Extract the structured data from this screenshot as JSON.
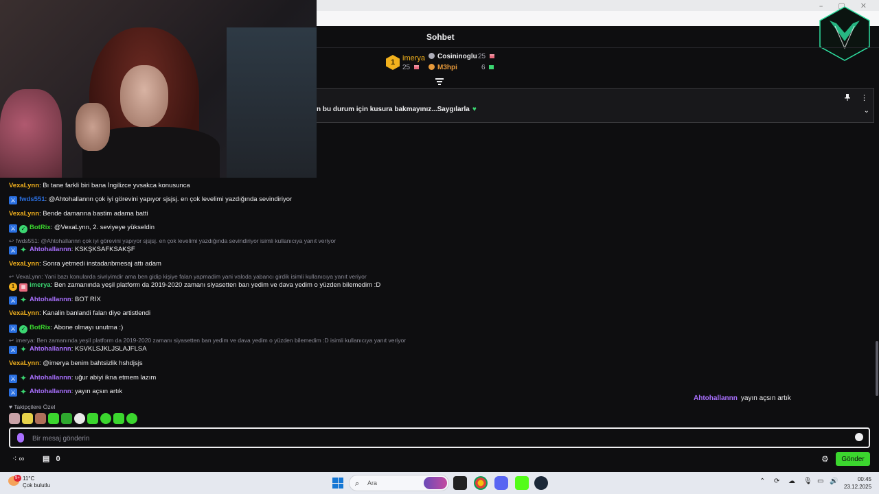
{
  "window": {
    "minimize": "–",
    "maximize": "▢",
    "close": "✕"
  },
  "chat_header": {
    "title": "Sohbet"
  },
  "leaderboard": {
    "first": {
      "rank": "1",
      "name": "imerya",
      "value": "25"
    },
    "second": {
      "name": "Cosininoglu",
      "value": "25"
    },
    "third": {
      "name": "M3hpi",
      "value": "6"
    }
  },
  "pinned": {
    "text": "n bu durum için kusura bakmayınız...Saygılarla",
    "heart": "♥"
  },
  "messages": [
    {
      "user": "VexaLynn",
      "text": ": Bı tane farkli biri bana İngilizce yvsakca konusunca"
    },
    {
      "user": "fwds551",
      "text": ": @Ahtohallannn çok iyi görevini yapıyor sjsjsj. en çok levelimi yazdığında sevindiriyor"
    },
    {
      "user": "VexaLynn",
      "text": ": Bende damarına bastim adama batti"
    },
    {
      "user": "BotRix",
      "text": ": @VexaLynn, 2. seviyeye yükseldin"
    },
    {
      "reply": "fwds551: @Ahtohallannn çok iyi görevini yapıyor sjsjsj. en çok levelimi yazdığında sevindiriyor isimli kullanıcıya yanıt veriyor"
    },
    {
      "user": "Ahtohallannn",
      "text": ": KSKŞKSAFKSAKŞF"
    },
    {
      "user": "VexaLynn",
      "text": ": Sonra yetmedi instadanbmesaj attı adam"
    },
    {
      "reply": "VexaLynn: Yani bazı konularda sivriyimdir ama ben gidip kişiye falan yapmadim yani valoda yabancı girdik isimli kullanıcıya yanıt veriyor"
    },
    {
      "user": "imerya",
      "text": ": Ben zamanında yeşil platform da 2019-2020 zamanı siyasetten ban yedim ve dava yedim o yüzden bilemedim :D"
    },
    {
      "user": "Ahtohallannn",
      "text": ": BOT RİX"
    },
    {
      "user": "VexaLynn",
      "text": ": Kanalin banlandi falan diye artistlendi"
    },
    {
      "user": "BotRix",
      "text": ": Abone olmayı unutma :)"
    },
    {
      "reply": "imerya: Ben zamanında yeşil platform da 2019-2020 zamanı siyasetten ban yedim ve dava yedim o yüzden bilemedim :D isimli kullanıcıya yanıt veriyor"
    },
    {
      "user": "Ahtohallannn",
      "text": ": KSVKLSJKLJSLAJFLSA"
    },
    {
      "user": "VexaLynn",
      "text": ": @imerya benim bahtsizlik hshdjsjs"
    },
    {
      "user": "Ahtohallannn",
      "text": ": uğur abiyi ikna etmem lazım"
    },
    {
      "user": "Ahtohallannn",
      "text": ": yayın açsın artık"
    }
  ],
  "overlay": {
    "user": "Ahtohallannn",
    "text": "yayın açsın artık"
  },
  "followers_label": "Takipçilere Özel",
  "input": {
    "placeholder": "Bir mesaj gönderin"
  },
  "bottom": {
    "points": "∞",
    "store_count": "0",
    "send_label": "Gönder"
  },
  "taskbar": {
    "weather_temp": "11°C",
    "weather_desc": "Çok bulutlu",
    "weather_badge": "9+",
    "search_label": "Ara",
    "time": "00:45",
    "date": "23.12.2025"
  },
  "colors": {
    "vexalynn": "#f2b11d",
    "fwds551": "#2a6fe0",
    "botrix": "#3bd62e",
    "ahtohallannn": "#a970ff",
    "imerya": "#3bd671",
    "accent_send": "#3bd62e"
  }
}
